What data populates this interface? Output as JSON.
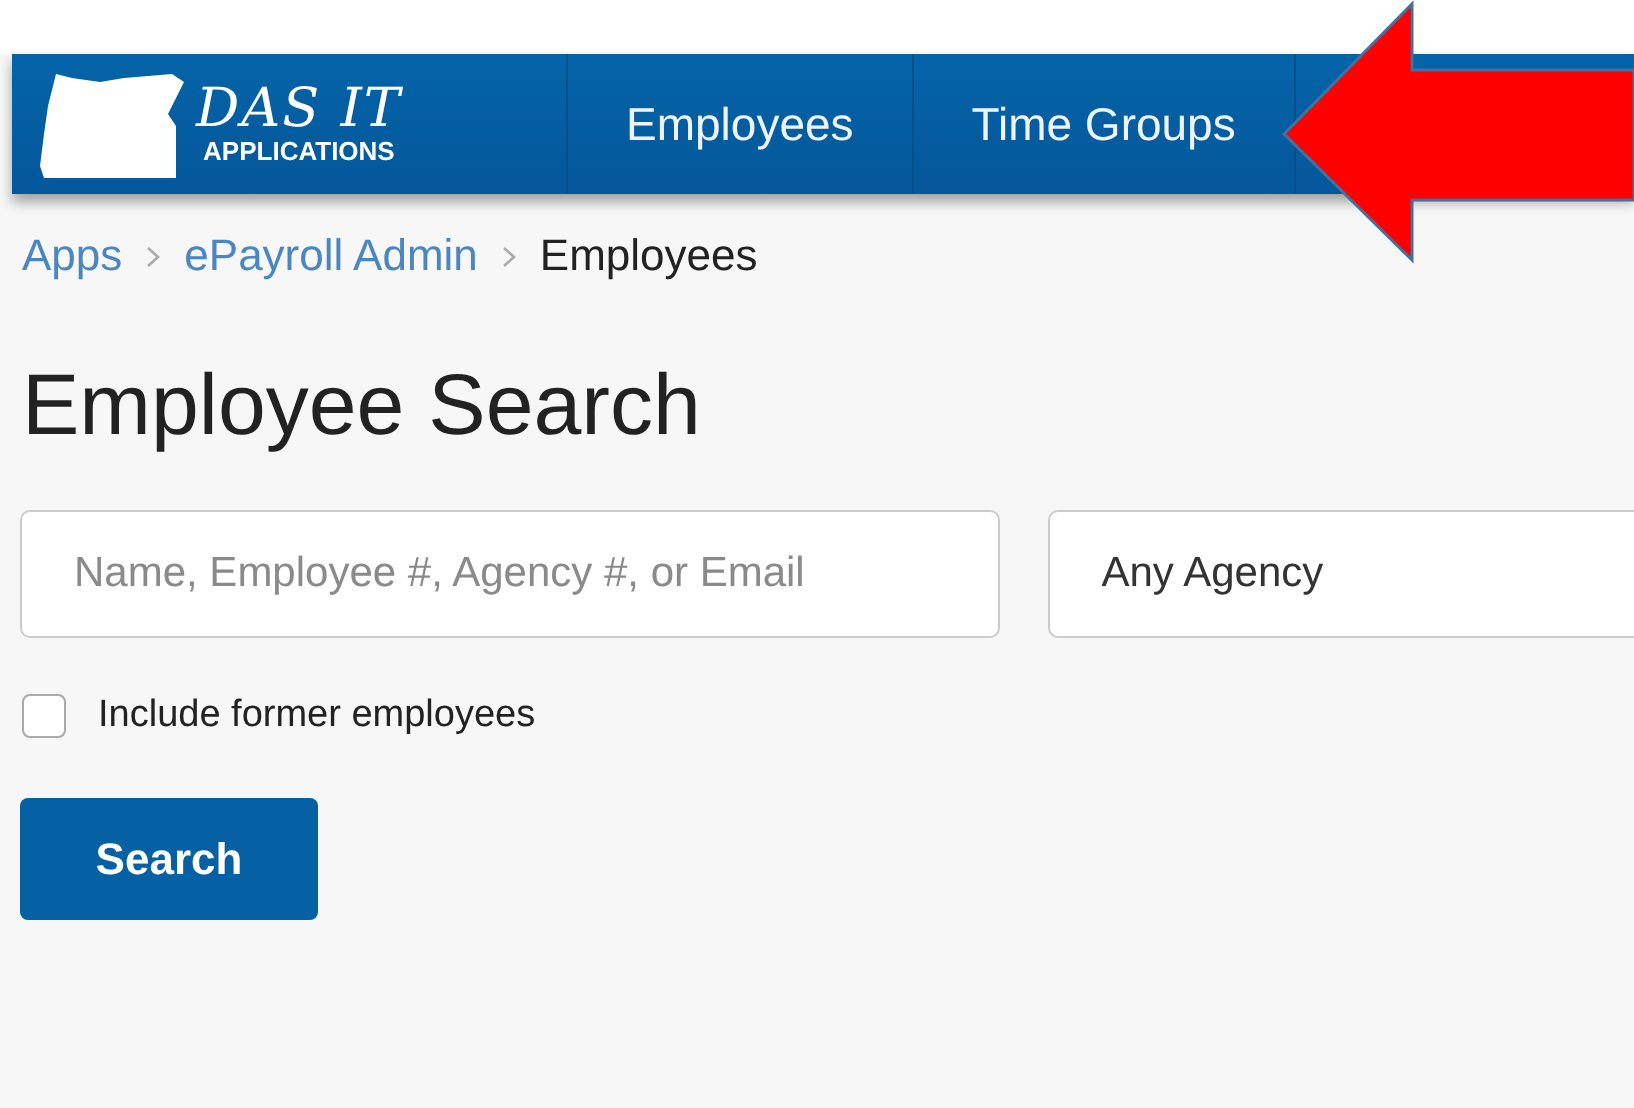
{
  "logo": {
    "title": "DAS IT",
    "subtitle": "APPLICATIONS"
  },
  "nav": [
    {
      "label": "Employees"
    },
    {
      "label": "Time Groups"
    }
  ],
  "breadcrumb": [
    {
      "label": "Apps",
      "kind": "link"
    },
    {
      "label": "ePayroll Admin",
      "kind": "link"
    },
    {
      "label": "Employees",
      "kind": "current"
    }
  ],
  "heading": "Employee Search",
  "search": {
    "placeholder": "Name, Employee #, Agency #, or Email"
  },
  "agency": {
    "value": "Any Agency"
  },
  "include_former": {
    "label": "Include former employees",
    "checked": false
  },
  "buttons": [
    "Search"
  ]
}
